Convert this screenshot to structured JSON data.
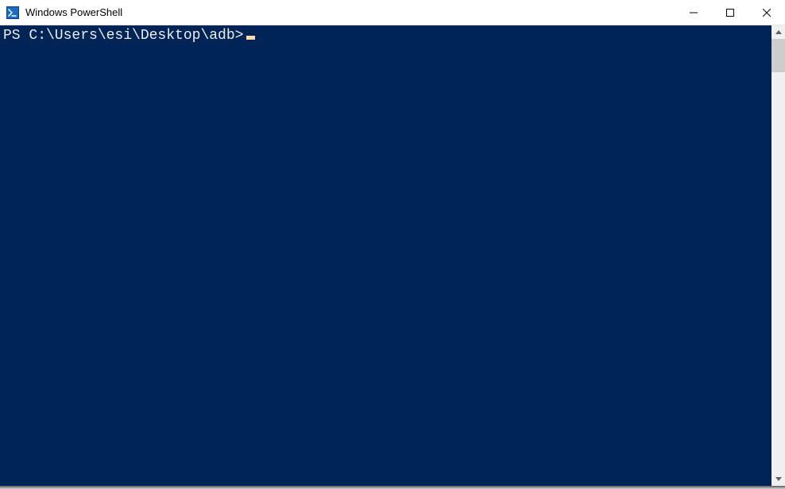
{
  "window": {
    "title": "Windows PowerShell"
  },
  "terminal": {
    "prompt": "PS C:\\Users\\esi\\Desktop\\adb>",
    "input": ""
  },
  "colors": {
    "console_bg": "#012456",
    "console_fg": "#eeedf0",
    "cursor": "#fedba9"
  }
}
